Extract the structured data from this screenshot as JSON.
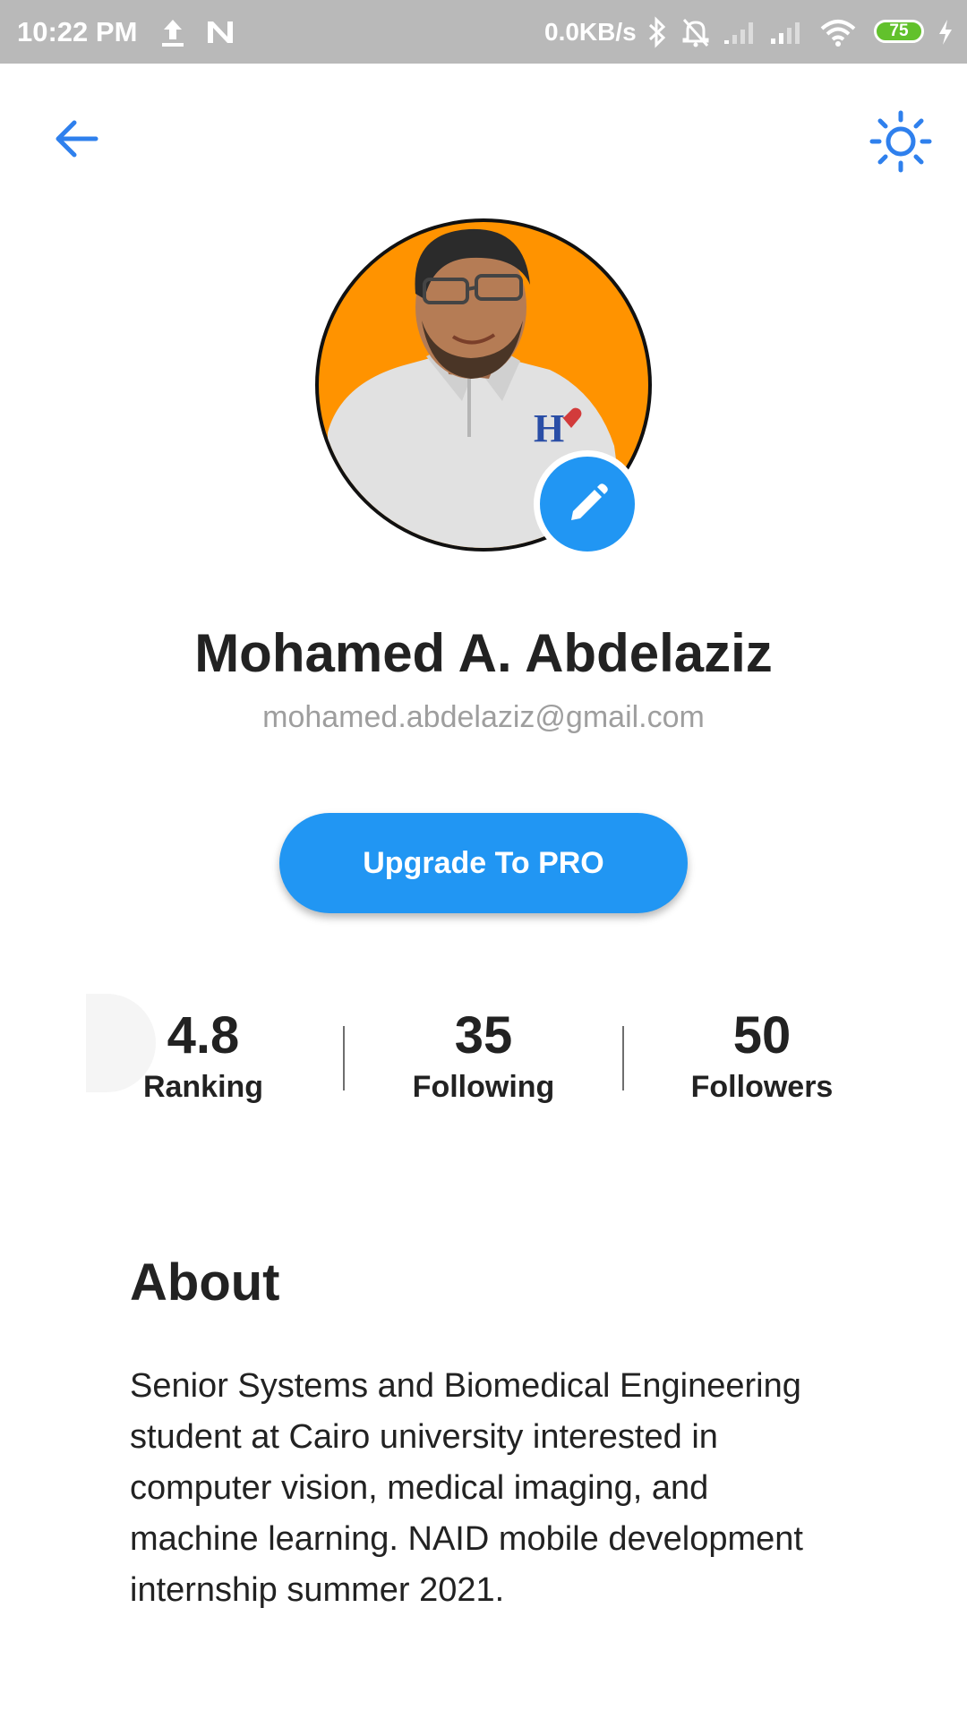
{
  "status_bar": {
    "time": "10:22 PM",
    "network_speed": "0.0KB/s",
    "battery_level": "75",
    "icons": [
      "upload-icon",
      "n-notification-icon",
      "bluetooth-icon",
      "mute-bell-icon",
      "signal-icon",
      "signal-icon",
      "wifi-icon",
      "battery-icon",
      "charging-icon"
    ]
  },
  "app_bar": {
    "back_icon": "back-arrow-icon",
    "theme_icon": "sun-icon",
    "accent_color": "#2196f3"
  },
  "profile": {
    "name": "Mohamed A. Abdelaziz",
    "email": "mohamed.abdelaziz@gmail.com",
    "avatar_background_color": "#ff9300",
    "edit_icon": "pencil-icon"
  },
  "upgrade_button": {
    "label": "Upgrade To PRO"
  },
  "stats": [
    {
      "value": "4.8",
      "label": "Ranking"
    },
    {
      "value": "35",
      "label": "Following"
    },
    {
      "value": "50",
      "label": "Followers"
    }
  ],
  "about": {
    "title": "About",
    "text": "Senior Systems and Biomedical Engineering student at Cairo university interested in computer vision, medical imaging, and machine learning. NAID mobile development internship summer 2021."
  }
}
